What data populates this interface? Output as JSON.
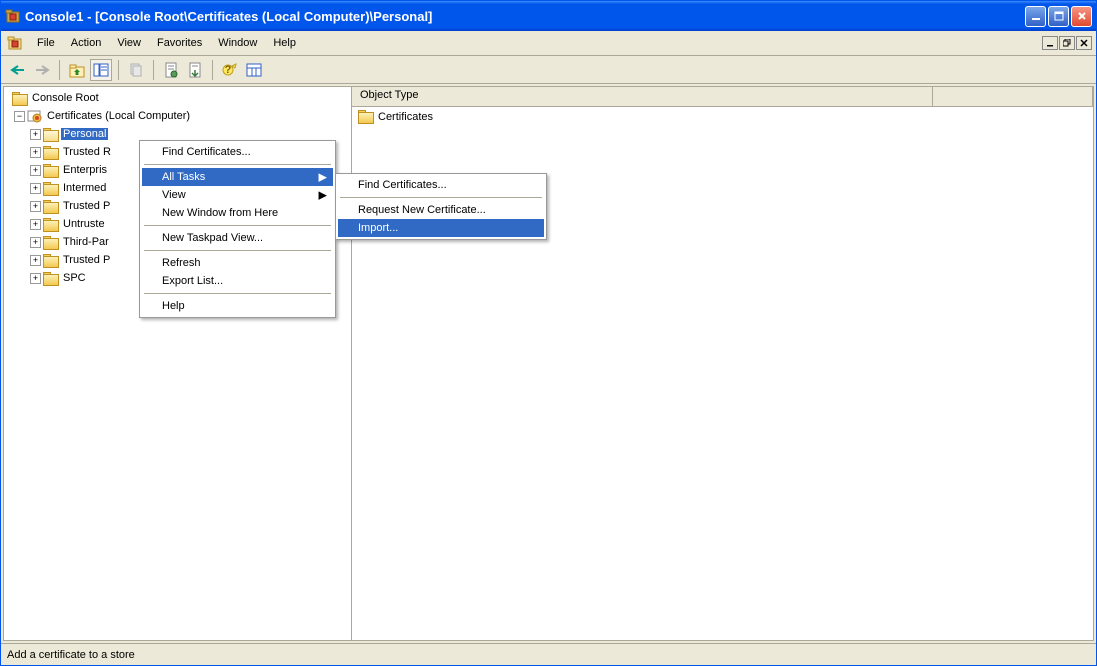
{
  "title": "Console1 - [Console Root\\Certificates (Local Computer)\\Personal]",
  "menubar": {
    "file": "File",
    "action": "Action",
    "view": "View",
    "favorites": "Favorites",
    "window": "Window",
    "help": "Help"
  },
  "tree": {
    "root": "Console Root",
    "snapin": "Certificates (Local Computer)",
    "nodes": [
      "Personal",
      "Trusted R",
      "Enterpris",
      "Intermed",
      "Trusted P",
      "Untruste",
      "Third-Par",
      "Trusted P",
      "SPC"
    ]
  },
  "listheader": {
    "col1": "Object Type"
  },
  "listitems": [
    "Certificates"
  ],
  "contextmenu1": {
    "find": "Find Certificates...",
    "alltasks": "All Tasks",
    "view": "View",
    "newwin": "New Window from Here",
    "newtaskpad": "New Taskpad View...",
    "refresh": "Refresh",
    "exportlist": "Export List...",
    "help": "Help"
  },
  "contextmenu2": {
    "find": "Find Certificates...",
    "request": "Request New Certificate...",
    "import": "Import..."
  },
  "statusbar": "Add a certificate to a store"
}
